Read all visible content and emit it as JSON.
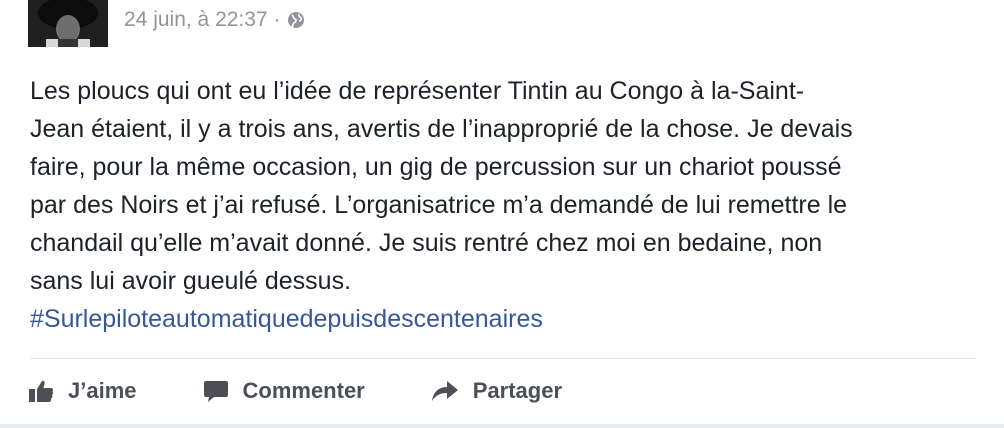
{
  "post": {
    "timestamp": "24 juin, à 22:37",
    "separator": "·",
    "privacy_icon": "globe-icon",
    "body": "Les ploucs qui ont eu l’idée de représenter Tintin au Congo à la-Saint-\nJean étaient, il y a trois ans, avertis de l’inapproprié de la chose. Je devais\nfaire, pour la même occasion, un gig de percussion sur un chariot poussé\npar des Noirs et j’ai refusé. L’organisatrice m’a demandé de lui remettre le\nchandail qu’elle m’avait donné. Je suis rentré chez moi en bedaine, non\nsans lui avoir gueulé dessus.",
    "hashtag": "#Surlepiloteautomatiquedepuisdescentenaires"
  },
  "actions": {
    "like": {
      "label": "J’aime",
      "icon": "thumbs-up-icon"
    },
    "comment": {
      "label": "Commenter",
      "icon": "comment-icon"
    },
    "share": {
      "label": "Partager",
      "icon": "share-arrow-icon"
    }
  },
  "colors": {
    "text": "#1d2129",
    "meta": "#90949c",
    "link": "#365899",
    "action": "#4b4f56"
  }
}
